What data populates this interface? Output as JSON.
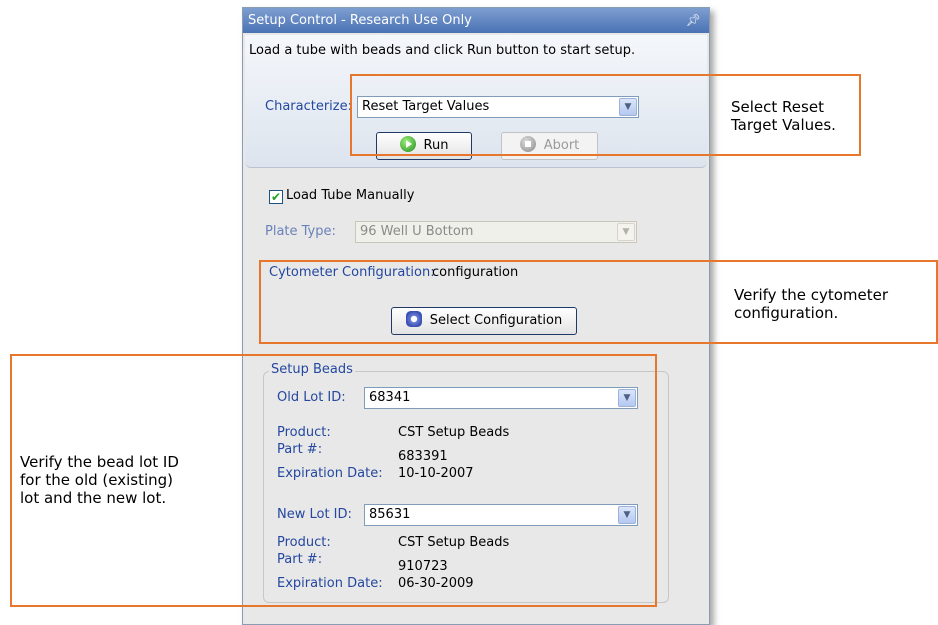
{
  "window": {
    "title": "Setup Control - Research Use Only",
    "pin_icon": "pin-icon"
  },
  "instructions": "Load a tube with beads and click Run button to start setup.",
  "characterize": {
    "label": "Characterize:",
    "value": "Reset Target Values"
  },
  "buttons": {
    "run": "Run",
    "abort": "Abort",
    "select_configuration": "Select Configuration"
  },
  "load_tube": {
    "label": "Load Tube Manually",
    "checked": true
  },
  "plate_type": {
    "label": "Plate Type:",
    "value": "96 Well U Bottom"
  },
  "cytometer": {
    "label": "Cytometer Configuration:",
    "value": "configuration"
  },
  "setup_beads": {
    "title": "Setup Beads",
    "old_lot": {
      "label": "Old Lot ID:",
      "value": "68341",
      "product_label": "Product:",
      "product": "CST Setup Beads",
      "part_label": "Part #:",
      "part": "683391",
      "exp_label": "Expiration Date:",
      "exp": "10-10-2007"
    },
    "new_lot": {
      "label": "New Lot ID:",
      "value": "85631",
      "product_label": "Product:",
      "product": "CST Setup Beads",
      "part_label": "Part #:",
      "part": "910723",
      "exp_label": "Expiration Date:",
      "exp": "06-30-2009"
    }
  },
  "callouts": {
    "reset": [
      "Select Reset",
      "Target Values."
    ],
    "cytometer": [
      "Verify the cytometer",
      "configuration."
    ],
    "bead_lot": [
      "Verify the bead lot ID",
      "for the old (existing)",
      "lot and the new lot."
    ]
  },
  "colors": {
    "callout_border": "#e8772e",
    "label_blue": "#2447a0",
    "titlebar": "#5a80be"
  }
}
